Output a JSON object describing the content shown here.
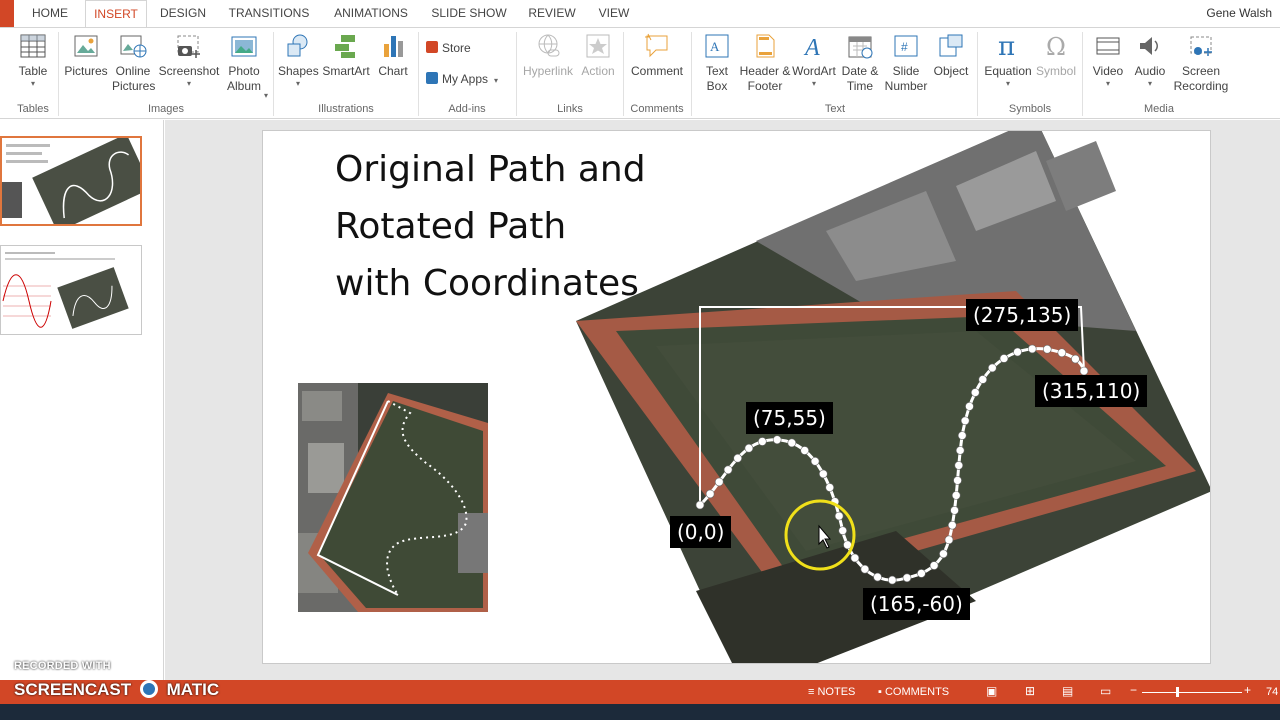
{
  "tabs": [
    {
      "label": "HOME",
      "active": false
    },
    {
      "label": "INSERT",
      "active": true
    },
    {
      "label": "DESIGN",
      "active": false
    },
    {
      "label": "TRANSITIONS",
      "active": false
    },
    {
      "label": "ANIMATIONS",
      "active": false
    },
    {
      "label": "SLIDE SHOW",
      "active": false
    },
    {
      "label": "REVIEW",
      "active": false
    },
    {
      "label": "VIEW",
      "active": false
    }
  ],
  "user": "Gene Walsh",
  "ribbon": {
    "table": "Table",
    "pictures": "Pictures",
    "online_pictures": "Online Pictures",
    "screenshot": "Screenshot",
    "photo_album": "Photo Album",
    "shapes": "Shapes",
    "smartart": "SmartArt",
    "chart": "Chart",
    "store": "Store",
    "my_apps": "My Apps",
    "hyperlink": "Hyperlink",
    "action": "Action",
    "comment": "Comment",
    "text_box": "Text Box",
    "header_footer": "Header & Footer",
    "wordart": "WordArt",
    "date_time": "Date & Time",
    "slide_number": "Slide Number",
    "object": "Object",
    "equation": "Equation",
    "symbol": "Symbol",
    "video": "Video",
    "audio": "Audio",
    "screen_recording": "Screen Recording",
    "groups": {
      "tables": "Tables",
      "images": "Images",
      "illustrations": "Illustrations",
      "addins": "Add-ins",
      "links": "Links",
      "comments": "Comments",
      "text": "Text",
      "symbols": "Symbols",
      "media": "Media"
    }
  },
  "slide": {
    "title_lines": [
      "Original Path and",
      "Rotated Path",
      "with Coordinates"
    ],
    "coords": {
      "origin": "(0,0)",
      "peak": "(75,55)",
      "trough": "(165,-60)",
      "top": "(275,135)",
      "end": "(315,110)"
    }
  },
  "status": {
    "notes": "NOTES",
    "comments": "COMMENTS",
    "zoom": "74"
  },
  "watermark": {
    "line1": "RECORDED WITH",
    "line2": "SCREENCAST",
    "line3": "MATIC"
  },
  "colors": {
    "accent": "#d24726",
    "selection": "#e0763d",
    "cursor_ring": "#f0e01a"
  }
}
